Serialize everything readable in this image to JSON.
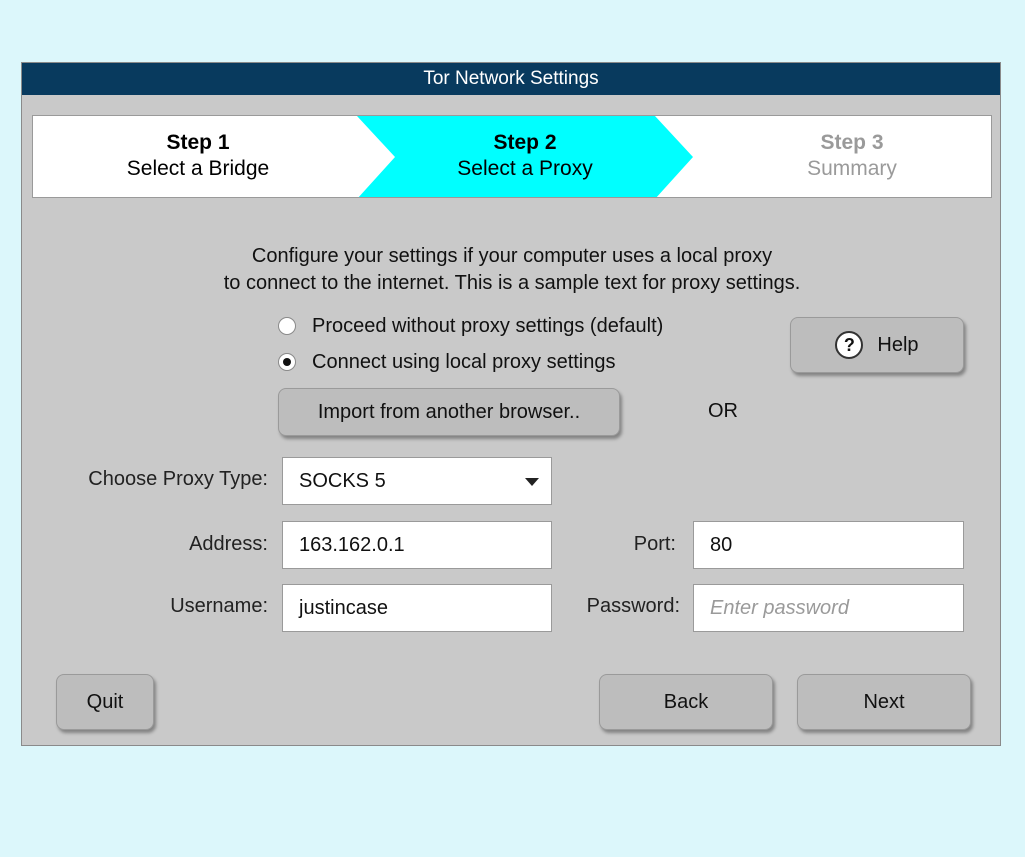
{
  "window": {
    "title": "Tor Network Settings"
  },
  "steps": [
    {
      "number": "Step 1",
      "label": "Select a Bridge",
      "state": "done"
    },
    {
      "number": "Step 2",
      "label": "Select a Proxy",
      "state": "active"
    },
    {
      "number": "Step 3",
      "label": "Summary",
      "state": "pending"
    }
  ],
  "colors": {
    "titlebar": "#083a5e",
    "active_step": "#00ffff",
    "window_bg": "#c9c9c9",
    "page_bg": "#dcf7fb",
    "inactive_text": "#9a9a9a"
  },
  "intro": {
    "line1": "Configure your settings if your computer uses a local proxy",
    "line2": "to connect to the internet. This is a sample text for proxy settings."
  },
  "options": {
    "no_proxy": "Proceed without proxy settings (default)",
    "local_proxy": "Connect using local proxy settings",
    "selected": "local_proxy"
  },
  "buttons": {
    "help": "Help",
    "help_icon": "?",
    "import": "Import from another browser..",
    "quit": "Quit",
    "back": "Back",
    "next": "Next"
  },
  "or_text": "OR",
  "form": {
    "proxy_type_label": "Choose Proxy Type:",
    "proxy_type_value": "SOCKS 5",
    "address_label": "Address:",
    "address_value": "163.162.0.1",
    "port_label": "Port:",
    "port_value": "80",
    "username_label": "Username:",
    "username_value": "justincase",
    "password_label": "Password:",
    "password_placeholder": "Enter password"
  }
}
